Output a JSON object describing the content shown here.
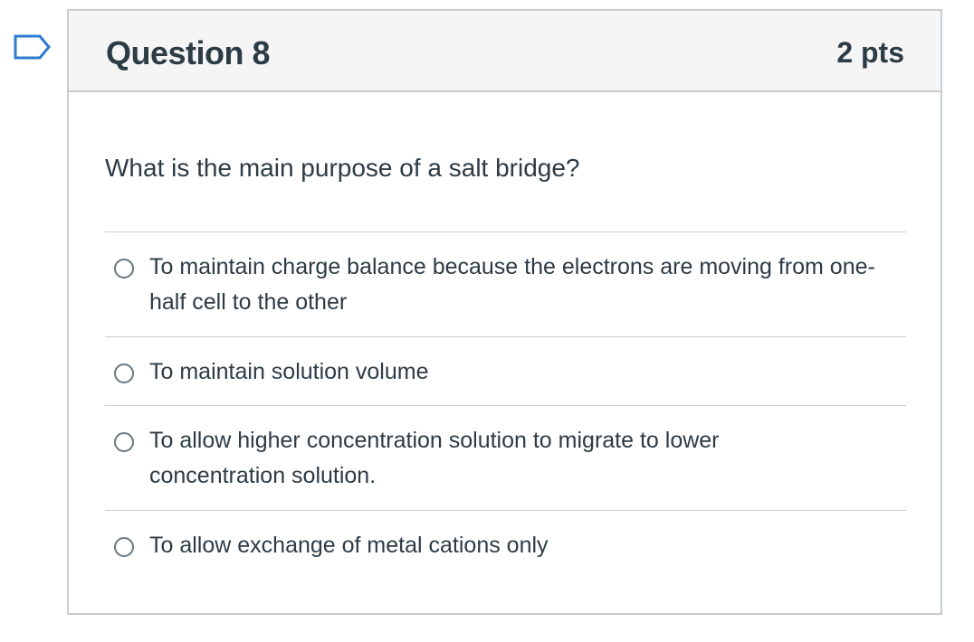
{
  "flag": {
    "icon": "bookmark-flag-icon"
  },
  "question": {
    "title": "Question 8",
    "points": "2 pts",
    "text": "What is the main purpose of a salt bridge?",
    "answers": [
      {
        "label": "To maintain charge balance because the electrons are moving from one-half cell to the other"
      },
      {
        "label": "To maintain solution volume"
      },
      {
        "label": "To allow higher concentration solution to migrate to lower concentration solution."
      },
      {
        "label": "To allow exchange of metal cations only"
      }
    ]
  },
  "colors": {
    "text": "#2d3b45",
    "border": "#c7cdd1",
    "header_bg": "#f5f5f5",
    "flag": "#2d7bd1"
  }
}
